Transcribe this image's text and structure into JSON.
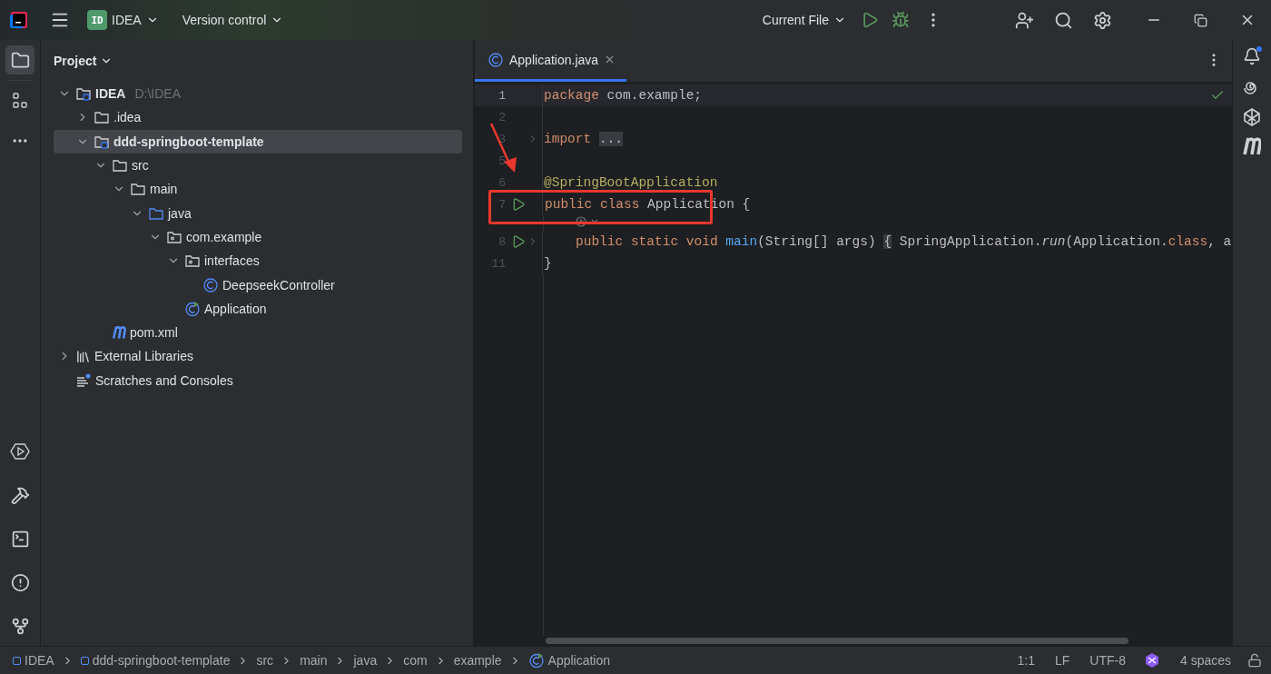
{
  "title_bar": {
    "project_badge": "ID",
    "project": "IDEA",
    "vcs": "Version control",
    "run_config": "Current File"
  },
  "project_panel": {
    "title": "Project",
    "tree": [
      {
        "label": "IDEA",
        "hint": "D:\\IDEA",
        "kind": "module",
        "expanded": true,
        "selected": false,
        "children": [
          {
            "label": ".idea",
            "kind": "folder",
            "expanded": false,
            "selected": false
          },
          {
            "label": "ddd-springboot-template",
            "kind": "module",
            "expanded": true,
            "selected": true,
            "children": [
              {
                "label": "src",
                "kind": "folder",
                "expanded": true,
                "selected": false,
                "children": [
                  {
                    "label": "main",
                    "kind": "folder",
                    "expanded": true,
                    "selected": false,
                    "children": [
                      {
                        "label": "java",
                        "kind": "source",
                        "expanded": true,
                        "selected": false,
                        "children": [
                          {
                            "label": "com.example",
                            "kind": "package",
                            "expanded": true,
                            "selected": false,
                            "children": [
                              {
                                "label": "interfaces",
                                "kind": "package",
                                "expanded": true,
                                "selected": false,
                                "children": [
                                  {
                                    "label": "DeepseekController",
                                    "kind": "class",
                                    "selected": false
                                  }
                                ]
                              },
                              {
                                "label": "Application",
                                "kind": "main-class",
                                "selected": false
                              }
                            ]
                          }
                        ]
                      }
                    ]
                  }
                ]
              },
              {
                "label": "pom.xml",
                "kind": "maven",
                "selected": false
              }
            ]
          }
        ]
      },
      {
        "label": "External Libraries",
        "kind": "libraries",
        "expanded": false,
        "selected": false
      },
      {
        "label": "Scratches and Consoles",
        "kind": "scratches",
        "selected": false
      }
    ]
  },
  "editor": {
    "tabs": [
      {
        "label": "Application.java",
        "selected": true
      }
    ],
    "lines": [
      {
        "number": "1",
        "tokens": [
          {
            "text": "package",
            "kind": "keyword"
          },
          {
            "text": " com.example;",
            "kind": "plain"
          }
        ]
      },
      {
        "number": "2"
      },
      {
        "number": "3",
        "fold": true,
        "tokens": [
          {
            "text": "import ",
            "kind": "keyword"
          },
          {
            "text": "...",
            "kind": "folded"
          }
        ]
      },
      {
        "number": "5"
      },
      {
        "number": "6",
        "tokens": [
          {
            "text": "@SpringBootApplication",
            "kind": "annotation"
          }
        ]
      },
      {
        "number": "7",
        "run": true,
        "hint_below": true,
        "tokens": [
          {
            "text": "public class",
            "kind": "keyword"
          },
          {
            "text": " Application {",
            "kind": "plain"
          }
        ]
      },
      {
        "number": "8",
        "run": true,
        "fold": true,
        "indented": true,
        "tokens": [
          {
            "text": "public static void ",
            "kind": "keyword"
          },
          {
            "text": "main",
            "kind": "method"
          },
          {
            "text": "(String[] args) ",
            "kind": "plain"
          },
          {
            "text": "{",
            "kind": "folded"
          },
          {
            "text": " SpringApplication.",
            "kind": "plain"
          },
          {
            "text": "run",
            "kind": "static"
          },
          {
            "text": "(Application.",
            "kind": "plain"
          },
          {
            "text": "class",
            "kind": "keyword"
          },
          {
            "text": ", a",
            "kind": "plain"
          }
        ]
      },
      {
        "number": "11",
        "tokens": [
          {
            "text": "}",
            "kind": "plain"
          }
        ]
      }
    ]
  },
  "status_bar": {
    "breadcrumbs": [
      {
        "label": "IDEA",
        "kind": "module"
      },
      {
        "label": "ddd-springboot-template",
        "kind": "module"
      },
      {
        "label": "src",
        "kind": "plain"
      },
      {
        "label": "main",
        "kind": "plain"
      },
      {
        "label": "java",
        "kind": "plain"
      },
      {
        "label": "com",
        "kind": "plain"
      },
      {
        "label": "example",
        "kind": "plain"
      },
      {
        "label": "Application",
        "kind": "class"
      }
    ],
    "position": "1:1",
    "line_separator": "LF",
    "encoding": "UTF-8",
    "indent": "4 spaces"
  }
}
